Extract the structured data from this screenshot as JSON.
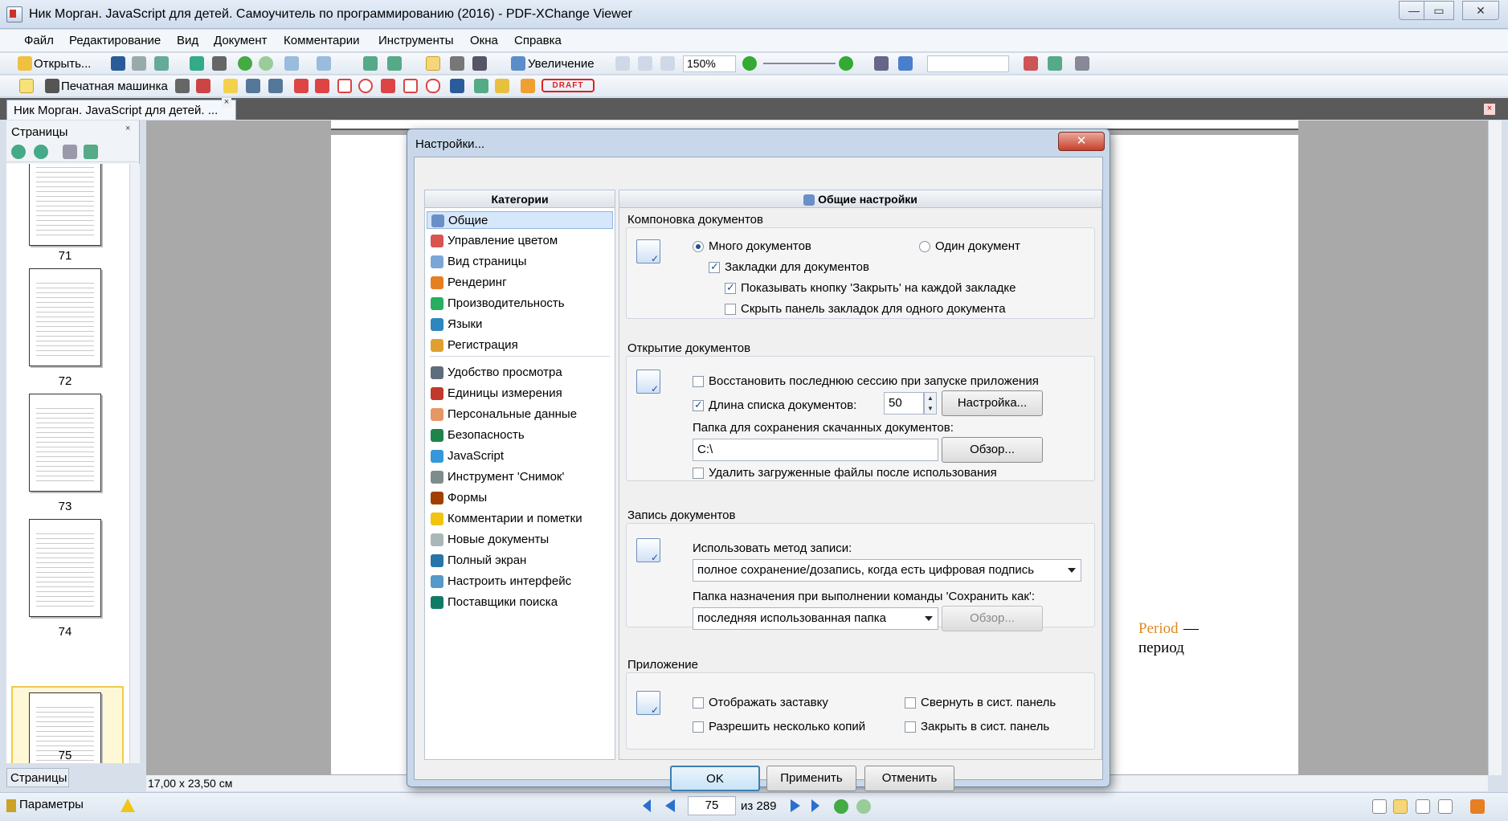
{
  "window": {
    "title": "Ник Морган. JavaScript для детей. Самоучитель по программированию (2016) - PDF-XChange Viewer",
    "min_label": "—",
    "max_label": "▭",
    "close_label": "✕"
  },
  "menu": [
    "Файл",
    "Редактирование",
    "Вид",
    "Документ",
    "Комментарии",
    "Инструменты",
    "Окна",
    "Справка"
  ],
  "toolbar": {
    "open_label": "Открыть...",
    "zoom_label": "Увеличение",
    "zoom_value": "150%",
    "typewriter_label": "Печатная машинка",
    "draft_label": "DRAFT"
  },
  "tab": {
    "label": "Ник Морган. JavaScript для детей. ...",
    "close_label": "×",
    "doc_close_label": "×"
  },
  "pages_panel": {
    "title": "Страницы",
    "close_label": "×",
    "bottom_tab": "Страницы",
    "thumbnails": [
      "71",
      "72",
      "73",
      "74",
      "75"
    ],
    "selected": "75"
  },
  "document": {
    "page_size": "17,00 x 23,50 см",
    "text_period_en": "Period",
    "text_dash": "—",
    "text_period_ru": "период"
  },
  "statusbar": {
    "params_label": "Параметры",
    "current_page": "75",
    "of_pages": "из 289"
  },
  "dialog": {
    "title": "Настройки...",
    "close_label": "✕",
    "categories_header": "Категории",
    "categories": [
      {
        "label": "Общие",
        "icon": "general-settings-icon",
        "color": "#6b8fc7"
      },
      {
        "label": "Управление цветом",
        "icon": "color-management-icon",
        "color": "#d9534f"
      },
      {
        "label": "Вид страницы",
        "icon": "page-view-icon",
        "color": "#7aa7d8"
      },
      {
        "label": "Рендеринг",
        "icon": "rendering-icon",
        "color": "#e67e22"
      },
      {
        "label": "Производительность",
        "icon": "performance-icon",
        "color": "#27ae60"
      },
      {
        "label": "Языки",
        "icon": "languages-icon",
        "color": "#2e86c1"
      },
      {
        "label": "Регистрация",
        "icon": "registration-icon",
        "color": "#e0a030"
      },
      {
        "label": "Удобство просмотра",
        "icon": "accessibility-icon",
        "color": "#5d6d7e"
      },
      {
        "label": "Единицы измерения",
        "icon": "units-icon",
        "color": "#c0392b"
      },
      {
        "label": "Персональные данные",
        "icon": "personal-data-icon",
        "color": "#e59866"
      },
      {
        "label": "Безопасность",
        "icon": "security-icon",
        "color": "#1e8449"
      },
      {
        "label": "JavaScript",
        "icon": "javascript-icon",
        "color": "#3498db"
      },
      {
        "label": "Инструмент 'Снимок'",
        "icon": "snapshot-icon",
        "color": "#7f8c8d"
      },
      {
        "label": "Формы",
        "icon": "forms-icon",
        "color": "#a04000"
      },
      {
        "label": "Комментарии и пометки",
        "icon": "comments-icon",
        "color": "#f1c40f"
      },
      {
        "label": "Новые документы",
        "icon": "new-documents-icon",
        "color": "#aab7b8"
      },
      {
        "label": "Полный экран",
        "icon": "full-screen-icon",
        "color": "#2874a6"
      },
      {
        "label": "Настроить интерфейс",
        "icon": "customize-ui-icon",
        "color": "#5499c7"
      },
      {
        "label": "Поставщики поиска",
        "icon": "search-providers-icon",
        "color": "#117a65"
      }
    ],
    "settings_header": "Общие настройки",
    "layout": {
      "title": "Компоновка документов",
      "many_docs": "Много документов",
      "one_doc": "Один документ",
      "tabs": "Закладки для документов",
      "show_close": "Показывать кнопку 'Закрыть' на каждой закладке",
      "hide_tabs": "Скрыть панель закладок для одного документа"
    },
    "opening": {
      "title": "Открытие документов",
      "restore_session": "Восстановить последнюю сессию при запуске приложения",
      "list_length": "Длина списка документов:",
      "list_length_value": "50",
      "setup_button": "Настройка...",
      "download_folder": "Папка для сохранения скачанных документов:",
      "download_folder_value": "C:\\",
      "browse_button": "Обзор...",
      "delete_downloaded": "Удалить загруженные файлы после использования"
    },
    "saving": {
      "title": "Запись документов",
      "method_label": "Использовать метод записи:",
      "method_value": "полное сохранение/дозапись, когда есть цифровая подпись",
      "save_as_label": "Папка назначения при выполнении команды 'Сохранить как':",
      "save_as_value": "последняя использованная папка",
      "browse_button": "Обзор..."
    },
    "app": {
      "title": "Приложение",
      "splash": "Отображать заставку",
      "multi_instance": "Разрешить несколько копий",
      "minimize_tray": "Свернуть в сист. панель",
      "close_tray": "Закрыть в сист. панель"
    },
    "buttons": {
      "ok": "OK",
      "apply": "Применить",
      "cancel": "Отменить"
    }
  }
}
